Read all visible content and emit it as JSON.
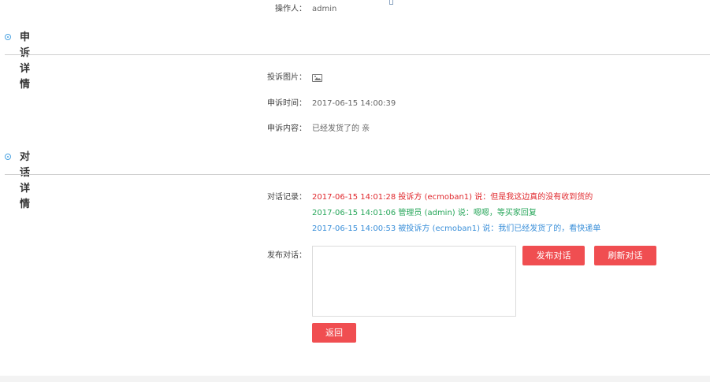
{
  "operator": {
    "label": "操作人：",
    "value": "admin"
  },
  "appeal_section": {
    "title": "申诉详情",
    "fields": {
      "image_label": "投诉图片：",
      "time_label": "申诉时间：",
      "time_value": "2017-06-15 14:00:39",
      "content_label": "申诉内容：",
      "content_value": "已经发货了的 亲"
    }
  },
  "dialog_section": {
    "title": "对话详情",
    "records_label": "对话记录：",
    "records": [
      {
        "text": "2017-06-15 14:01:28 投诉方 (ecmoban1) 说：但是我这边真的没有收到货的",
        "color": "#e0272c"
      },
      {
        "text": "2017-06-15 14:01:06 管理员 (admin) 说：嗯嗯，等买家回复",
        "color": "#27a65a"
      },
      {
        "text": "2017-06-15 14:00:53 被投诉方 (ecmoban1) 说：我们已经发货了的，看快递单",
        "color": "#3a8fd9"
      }
    ],
    "post_label": "发布对话：",
    "textarea_value": "",
    "post_button": "发布对话",
    "refresh_button": "刷新对话",
    "back_button": "返回"
  },
  "colors": {
    "accent_button": "#f04e51",
    "section_icon": "#4ba3e2"
  },
  "icons": {
    "section": "radio-dot-icon",
    "image": "image-icon"
  }
}
